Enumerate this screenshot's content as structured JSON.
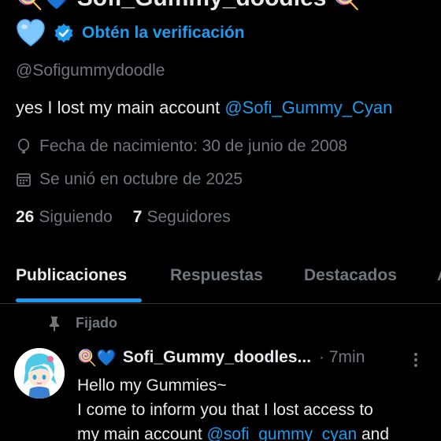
{
  "profile": {
    "display_name": "Sofi_Gummy_doodles",
    "name_emoji_left": "🍭💙",
    "name_emoji_right": "🍭",
    "verify_heart_icon": "blue-heart",
    "verify_link": "Obtén la verificación",
    "handle": "@Sofigummydoodle",
    "bio_text": "yes I lost my main account ",
    "bio_mention": "@Sofi_Gummy_Cyan",
    "birth": "Fecha de nacimiento: 30 de junio de 2008",
    "joined": "Se unió en octubre de 2025",
    "following_count": "26",
    "following_label": "Siguiendo",
    "followers_count": "7",
    "followers_label": "Seguidores"
  },
  "tabs": [
    {
      "label": "Publicaciones",
      "active": true
    },
    {
      "label": "Respuestas",
      "active": false
    },
    {
      "label": "Destacados",
      "active": false
    },
    {
      "label": "A",
      "active": false
    }
  ],
  "tweet": {
    "pinned_label": "Fijado",
    "emoji": "🍭💙",
    "author": "Sofi_Gummy_doodles...",
    "time": "· 7min",
    "line1": "Hello my Gummies~",
    "line2": "I come to inform you that I lost access to",
    "line3_text": "my main account ",
    "line3_mention": "@sofi_gummy_cyan",
    "line3_tail": " and"
  },
  "colors": {
    "background": "#000000",
    "accent": "#1d9bf0",
    "text": "#e7e9ea",
    "muted": "#71767b",
    "divider": "#2f3336"
  }
}
